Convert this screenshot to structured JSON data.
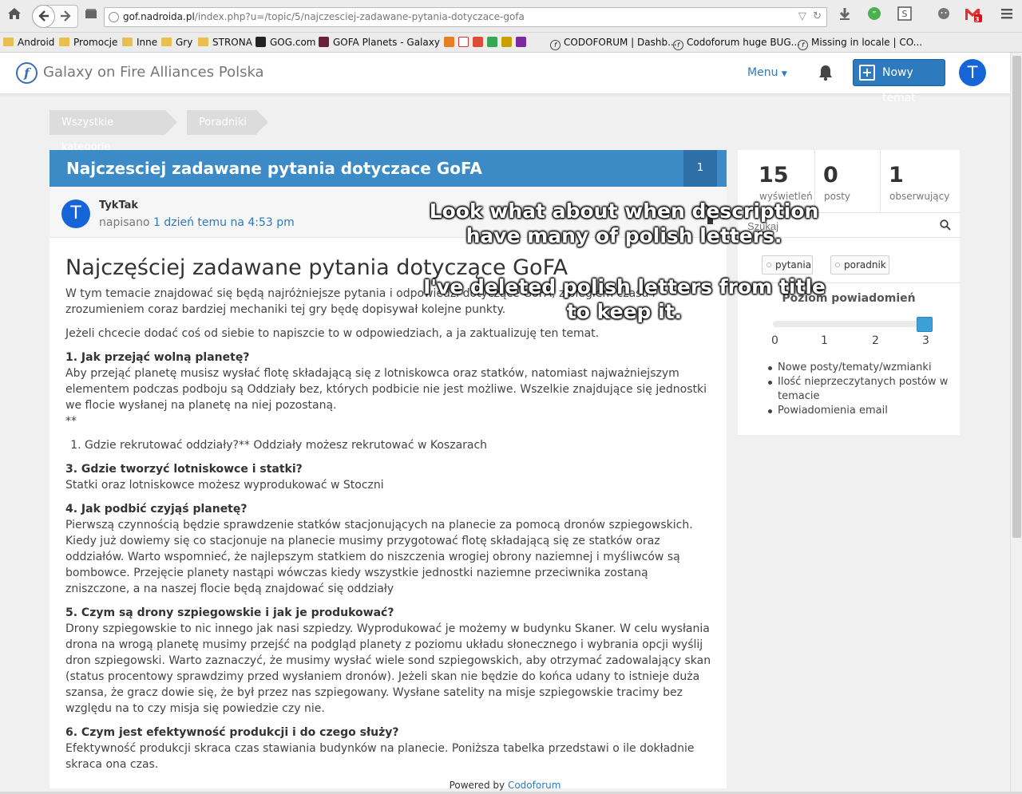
{
  "browser": {
    "url_host": "gof.nadroida.pl",
    "url_path": "/index.php?u=/topic/5/najczesciej-zadawane-pytania-dotyczace-gofa",
    "bookmarks": [
      {
        "label": "Android",
        "kind": "folder"
      },
      {
        "label": "Promocje",
        "kind": "folder"
      },
      {
        "label": "Inne",
        "kind": "folder"
      },
      {
        "label": "Gry",
        "kind": "folder"
      },
      {
        "label": "STRONA",
        "kind": "folder"
      },
      {
        "label": "GOG.com",
        "kind": "site"
      },
      {
        "label": "GOFA Planets - Galaxy ...",
        "kind": "site"
      },
      {
        "label": "CODOFORUM | Dashb...",
        "kind": "site"
      },
      {
        "label": "Codoforum huge BUG...",
        "kind": "site"
      },
      {
        "label": "Missing in locale | CO...",
        "kind": "site"
      }
    ],
    "mail_badge": "3"
  },
  "header": {
    "site_title": "Galaxy on Fire Alliances Polska",
    "menu_label": "Menu",
    "new_topic_label": "Nowy temat",
    "avatar_letter": "T"
  },
  "breadcrumb": [
    "Wszystkie kategorie",
    "Poradniki"
  ],
  "topic": {
    "title": "Najczesciej zadawane pytania dotyczace GoFA",
    "post_count": "1",
    "author": "TykTak",
    "avatar_letter": "T",
    "date_prefix": "napisano",
    "date_link": "1 dzień temu na 4:53 pm",
    "heading": "Najczęściej zadawane pytania dotyczące GoFA",
    "paragraphs": {
      "intro1": "W tym temacie znajdować się będą najróżniejsze pytania i odpowiedzi dotyczące GoFA, z biegiem czasu i zrozumieniem coraz bardziej mechaniki tej gry będę dopisywał kolejne punkty.",
      "intro2": "Jeżeli chcecie dodać coś od siebie to napiszcie to w odpowiedziach, a ja zaktualizuję ten temat.",
      "q1": "1. Jak przejąć wolną planetę?",
      "a1": "Aby przejąć planetę musisz wysłać flotę składającą się z lotniskowca oraz statków, natomiast najważniejszym elementem podczas podboju są Oddziały bez, których podbicie nie jest możliwe. Wszelkie znajdujące się jednostki we flocie wysłanej na planetę na niej pozostaną.",
      "stars": "**",
      "list_item": "Gdzie rekrutować oddziały?** Oddziały możesz rekrutować w Koszarach",
      "q3": "3. Gdzie tworzyć lotniskowce i statki?",
      "a3": "Statki oraz lotniskowce możesz wyprodukować w Stoczni",
      "q4": "4. Jak podbić czyjąś planetę?",
      "a4": "Pierwszą czynnością będzie sprawdzenie statków stacjonujących na planecie za pomocą dronów szpiegowskich. Kiedy już dowiemy się co stacjonuje na planecie musimy przygotować flotę składającą się ze statków oraz oddziałów. Warto wspomnieć, że najlepszym statkiem do niszczenia wrogiej obrony naziemnej i myśliwców są bombowce. Przejęcie planety nastąpi wówczas kiedy wszystkie jednostki naziemne przeciwnika zostaną zniszczone, a na naszej flocie będą znajdować się oddziały",
      "q5": "5. Czym są drony szpiegowskie i jak je produkować?",
      "a5": "Drony szpiegowskie to nic innego jak nasi szpiedzy. Wyprodukować je możemy w budynku Skaner. W celu wysłania drona na wrogą planetę musimy przejść na podgląd planety z poziomu układu słonecznego i wybrania opcji wyślij dron szpiegowski. Warto zaznaczyć, że musimy wysłać wiele sond szpiegowskich, aby otrzymać zadowalający skan (status procentowy sprawdzimy przed wysłaniem dronów). Jeżeli skan nie będzie do końca udany to istnieje duża szansa, że gracz dowie się, że był przez nas szpiegowany. Wysłane satelity na misje szpiegowskie tracimy bez względu na to czy misja się powiedzie czy nie.",
      "q6": "6. Czym jest efektywność produkcji i do czego służy?",
      "a6": "Efektywność produkcji skraca czas stawiania budynków na planecie. Poniższa tabelka przedstawi o ile dokładnie skraca ona czas."
    }
  },
  "sidebar": {
    "stats": [
      {
        "value": "15",
        "label": "wyświetleń"
      },
      {
        "value": "0",
        "label": "posty"
      },
      {
        "value": "1",
        "label": "obserwujący"
      }
    ],
    "search_placeholder": "Szukaj",
    "tags": [
      "pytania",
      "poradnik"
    ],
    "notif_title": "Poziom powiadomień",
    "notif_level": 3,
    "slider_labels": [
      "0",
      "1",
      "2",
      "3"
    ],
    "notif_items": [
      "Nowe posty/tematy/wzmianki",
      "Ilość nieprzeczytanych postów w temacie",
      "Powiadomienia email"
    ]
  },
  "annotations": {
    "line1": "Look what about when description",
    "line2": "have many of polish letters.",
    "line3": "I've deleted polish letters from title",
    "line4": "to keep it."
  },
  "footer": {
    "prefix": "Powered by",
    "link": "Codoforum"
  }
}
